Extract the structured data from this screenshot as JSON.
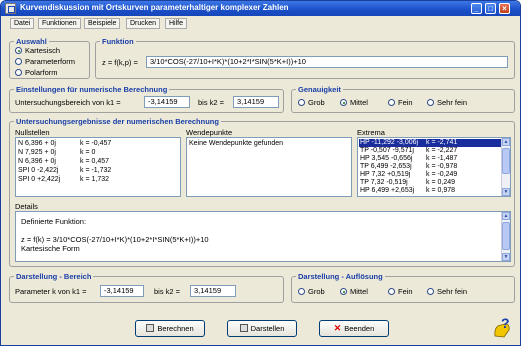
{
  "title": "Kurvendiskussion mit Ortskurven parameterhaltiger komplexer Zahlen",
  "titlebar_buttons": {
    "minimize": "_",
    "maximize": "□",
    "close": "×"
  },
  "menu": [
    "Datei",
    "Funktionen",
    "Beispiele",
    "Drucken",
    "Hilfe"
  ],
  "auswahl": {
    "title": "Auswahl",
    "options": [
      "Kartesisch",
      "Parameterform",
      "Polarform"
    ],
    "selected": "Kartesisch"
  },
  "funktion": {
    "title": "Funktion",
    "label": "z = f(k,p) =",
    "value": "3/10*COS(-27/10+I*K)*(10+2*I*SIN(5*K+I))+10"
  },
  "einstellungen": {
    "title": "Einstellungen für numerische Berechnung",
    "label_from": "Untersuchungsbereich von k1 =",
    "k1": "-3,14159",
    "label_to": "bis k2 =",
    "k2": "3,14159"
  },
  "genauigkeit": {
    "title": "Genauigkeit",
    "options": [
      "Grob",
      "Mittel",
      "Fein",
      "Sehr fein"
    ],
    "selected": "Mittel"
  },
  "ergebnisse": {
    "title": "Untersuchungsergebnisse der numerischen Berechnung",
    "nullstellen": {
      "header": "Nullstellen",
      "rows": [
        {
          "z": "N 6,396 + 0j",
          "k": "k = -0,457"
        },
        {
          "z": "N 7,925 + 0j",
          "k": "k = 0"
        },
        {
          "z": "N 6,396 + 0j",
          "k": "k = 0,457"
        },
        {
          "z": "SPI 0 -2,422j",
          "k": "k = -1,732"
        },
        {
          "z": "SPI 0 +2,422j",
          "k": "k = 1,732"
        }
      ]
    },
    "wendepunkte": {
      "header": "Wendepunkte",
      "rows": [
        "Keine Wendepunkte gefunden"
      ]
    },
    "extrema": {
      "header": "Extrema",
      "rows": [
        {
          "z": "HP -11,292 -3,006j",
          "k": "k = -2,741",
          "selected": true
        },
        {
          "z": "TP -0,507 -9,571j",
          "k": "k = -2,227"
        },
        {
          "z": "HP 3,545 -0,656j",
          "k": "k = -1,487"
        },
        {
          "z": "TP 6,499 -2,653j",
          "k": "k = -0,978"
        },
        {
          "z": "HP 7,32 +0,519j",
          "k": "k = -0,249"
        },
        {
          "z": "TP 7,32 -0,519j",
          "k": "k = 0,249"
        },
        {
          "z": "HP 6,499 +2,653j",
          "k": "k = 0,978"
        }
      ]
    }
  },
  "details": {
    "title": "Details",
    "lines": [
      "Definierte Funktion:",
      "",
      "z = f(k) = 3/10*COS(-27/10+I*K)*(10+2*I*SIN(5*K+I))+10",
      "Kartesische Form"
    ]
  },
  "darstellung_bereich": {
    "title": "Darstellung - Bereich",
    "label_from": "Parameter k von k1 =",
    "k1": "-3,14159",
    "label_to": "bis k2 =",
    "k2": "3,14159"
  },
  "darstellung_aufloesung": {
    "title": "Darstellung - Auflösung",
    "options": [
      "Grob",
      "Mittel",
      "Fein",
      "Sehr fein"
    ],
    "selected": "Mittel"
  },
  "buttons": {
    "berechnen": "Berechnen",
    "darstellen": "Darstellen",
    "beenden": "Beenden"
  },
  "help_icon": "?"
}
